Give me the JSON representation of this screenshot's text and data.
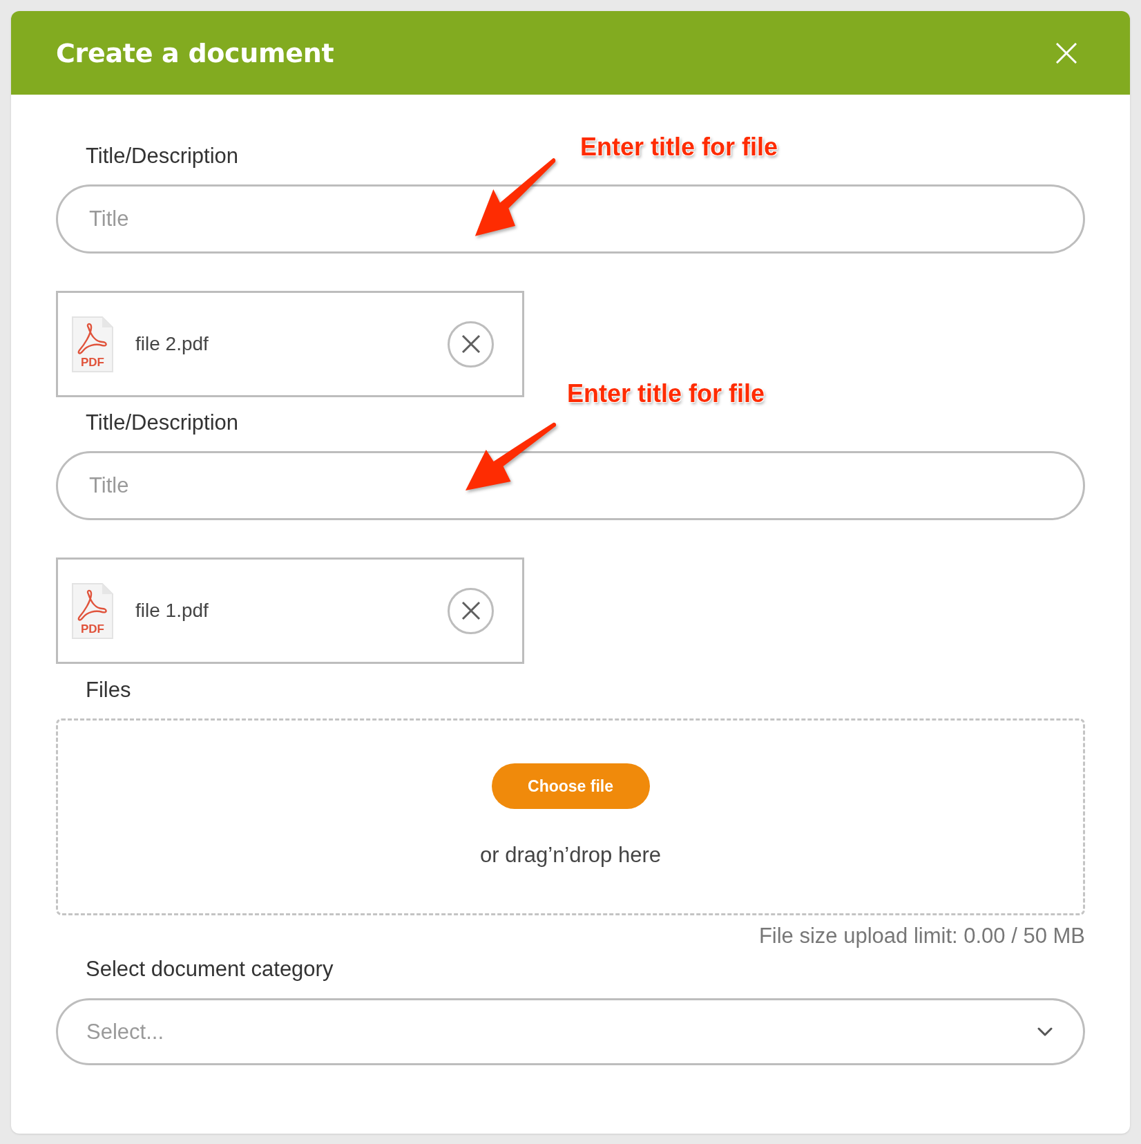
{
  "dialog": {
    "title": "Create a document"
  },
  "documents": [
    {
      "field_label": "Title/Description",
      "annotation": "Enter title for file",
      "title_field": {
        "placeholder": "Title"
      },
      "file": {
        "name": "file 2.pdf",
        "type_label": "PDF"
      }
    },
    {
      "field_label": "Title/Description",
      "annotation": "Enter title for file",
      "title_field": {
        "placeholder": "Title"
      },
      "file": {
        "name": "file 1.pdf",
        "type_label": "PDF"
      }
    }
  ],
  "upload": {
    "label": "Files",
    "button": "Choose file",
    "hint": "or drag’n’drop here",
    "limit": "File size upload limit: 0.00 / 50 MB"
  },
  "category": {
    "label": "Select document category",
    "select": {
      "placeholder": "Select..."
    }
  }
}
